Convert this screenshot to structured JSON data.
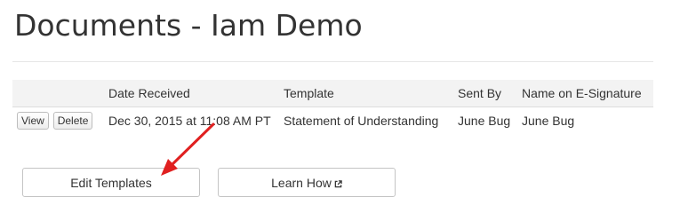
{
  "page": {
    "title": "Documents - Iam Demo"
  },
  "table": {
    "columns": [
      "",
      "Date Received",
      "Template",
      "Sent By",
      "Name on E-Signature"
    ],
    "rows": [
      {
        "view_label": "View",
        "delete_label": "Delete",
        "date_received": "Dec 30, 2015 at 11:08 AM PT",
        "template": "Statement of Understanding",
        "sent_by": "June Bug",
        "name_on_esignature": "June Bug"
      }
    ]
  },
  "buttons": {
    "edit_templates_label": "Edit Templates",
    "learn_how_label": "Learn How"
  },
  "icons": {
    "learn_how_icon": "external-link-icon",
    "annotation": "red-arrow"
  },
  "colors": {
    "annotation_arrow": "#e02020",
    "header_row_bg": "#f3f3f3"
  }
}
